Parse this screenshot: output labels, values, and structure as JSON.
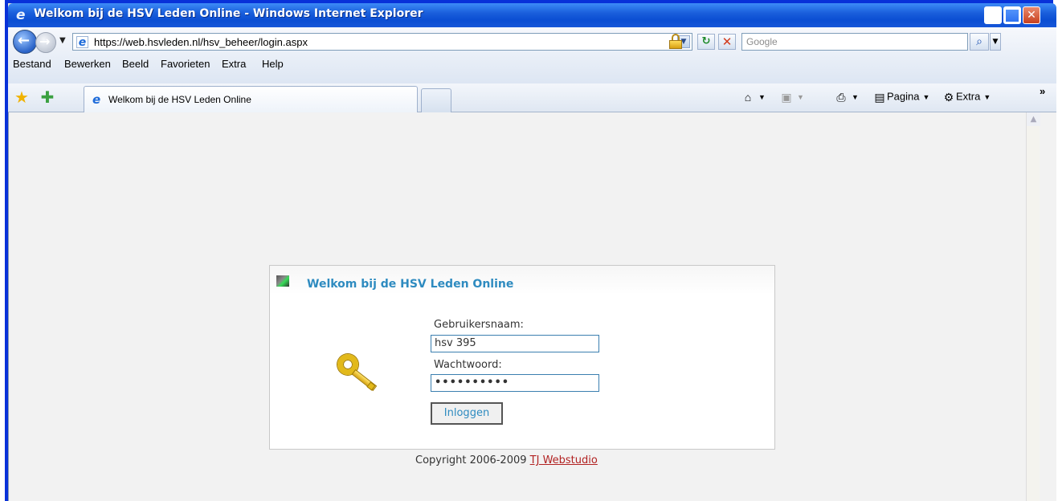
{
  "window": {
    "title": "Welkom bij de HSV Leden Online - Windows Internet Explorer"
  },
  "address": {
    "url": "https://web.hsvleden.nl/hsv_beheer/login.aspx",
    "search_placeholder": "Google"
  },
  "menu": {
    "items": [
      {
        "label": "Bestand"
      },
      {
        "label": "Bewerken"
      },
      {
        "label": "Beeld"
      },
      {
        "label": "Favorieten"
      },
      {
        "label": "Extra"
      },
      {
        "label": "Help"
      }
    ]
  },
  "tabs": {
    "active_label": "Welkom bij de HSV Leden Online"
  },
  "toolbar": {
    "page_label": "Pagina",
    "tools_label": "Extra"
  },
  "login": {
    "header_title": "Welkom bij de HSV Leden Online",
    "username_label": "Gebruikersnaam:",
    "username_value": "hsv 395",
    "password_label": "Wachtwoord:",
    "password_value": "••••••••••",
    "submit_label": "Inloggen"
  },
  "footer": {
    "copyright_text": "Copyright 2006-2009",
    "link_text": "TJ Webstudio"
  },
  "colors": {
    "title_bar": "#0b4ed3",
    "heading_accent": "#2e8bc0",
    "link": "#b22222"
  }
}
